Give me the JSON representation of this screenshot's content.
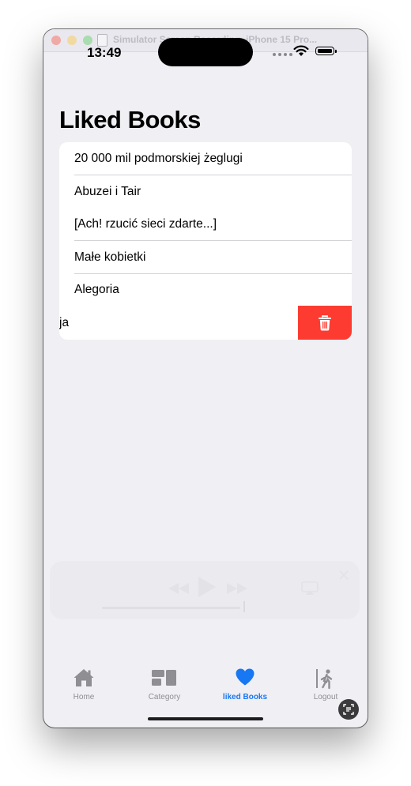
{
  "window": {
    "title": "Simulator Screen Recording_iPhone 15 Pro..."
  },
  "status_bar": {
    "time": "13:49"
  },
  "page": {
    "title": "Liked Books"
  },
  "liked_books": [
    "20 000 mil podmorskiej żeglugi",
    "Abuzei i Tair",
    "[Ach! rzucić sieci zdarte...]",
    "Małe kobietki",
    "Alegoria"
  ],
  "swiped_item": {
    "visible_text": "ja"
  },
  "tabs": [
    {
      "label": "Home",
      "icon": "house-icon"
    },
    {
      "label": "Category",
      "icon": "category-icon"
    },
    {
      "label": "liked Books",
      "icon": "heart-icon"
    },
    {
      "label": "Logout",
      "icon": "logout-icon"
    }
  ],
  "active_tab": "liked Books",
  "colors": {
    "accent": "#1877f2",
    "delete": "#fe3b30",
    "background": "#efeff4",
    "tab_inactive": "#8e8e93"
  }
}
